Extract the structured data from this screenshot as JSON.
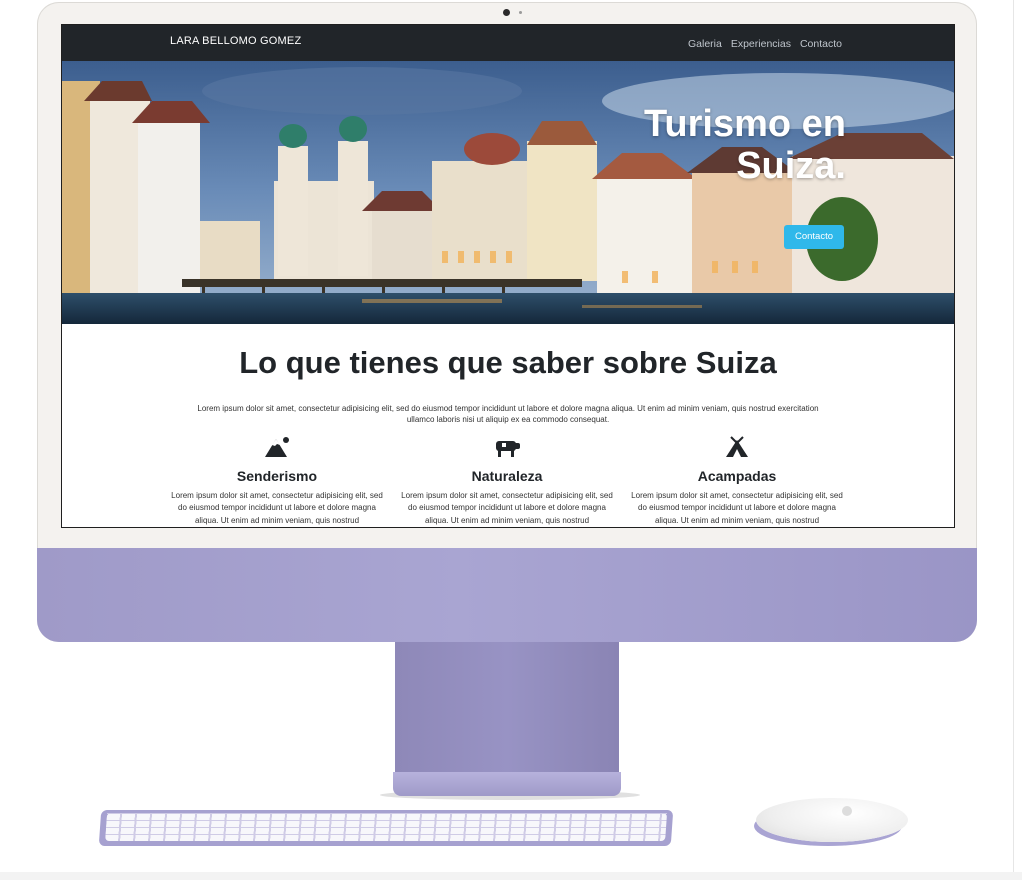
{
  "navbar": {
    "brand": "LARA BELLOMO GOMEZ",
    "links": [
      "Galeria",
      "Experiencias",
      "Contacto"
    ]
  },
  "hero": {
    "title": "Turismo en Suiza.",
    "button_label": "Contacto"
  },
  "about": {
    "title": "Lo que tienes que saber sobre Suiza",
    "intro": "Lorem ipsum dolor sit amet, consectetur adipisicing elit, sed do eiusmod tempor incididunt ut labore et dolore magna aliqua. Ut enim ad minim veniam, quis nostrud exercitation ullamco laboris nisi ut aliquip ex ea commodo consequat."
  },
  "features": [
    {
      "icon": "mountain-icon",
      "title": "Senderismo",
      "text": "Lorem ipsum dolor sit amet, consectetur adipisicing elit, sed do eiusmod tempor incididunt ut labore et dolore magna aliqua. Ut enim ad minim veniam, quis nostrud"
    },
    {
      "icon": "cow-icon",
      "title": "Naturaleza",
      "text": "Lorem ipsum dolor sit amet, consectetur adipisicing elit, sed do eiusmod tempor incididunt ut labore et dolore magna aliqua. Ut enim ad minim veniam, quis nostrud"
    },
    {
      "icon": "campground-icon",
      "title": "Acampadas",
      "text": "Lorem ipsum dolor sit amet, consectetur adipisicing elit, sed do eiusmod tempor incididunt ut labore et dolore magna aliqua. Ut enim ad minim veniam, quis nostrud"
    }
  ],
  "colors": {
    "navbar_bg": "#212529",
    "accent_button": "#2fb8ea",
    "imac_purple": "#a9a5d2"
  }
}
